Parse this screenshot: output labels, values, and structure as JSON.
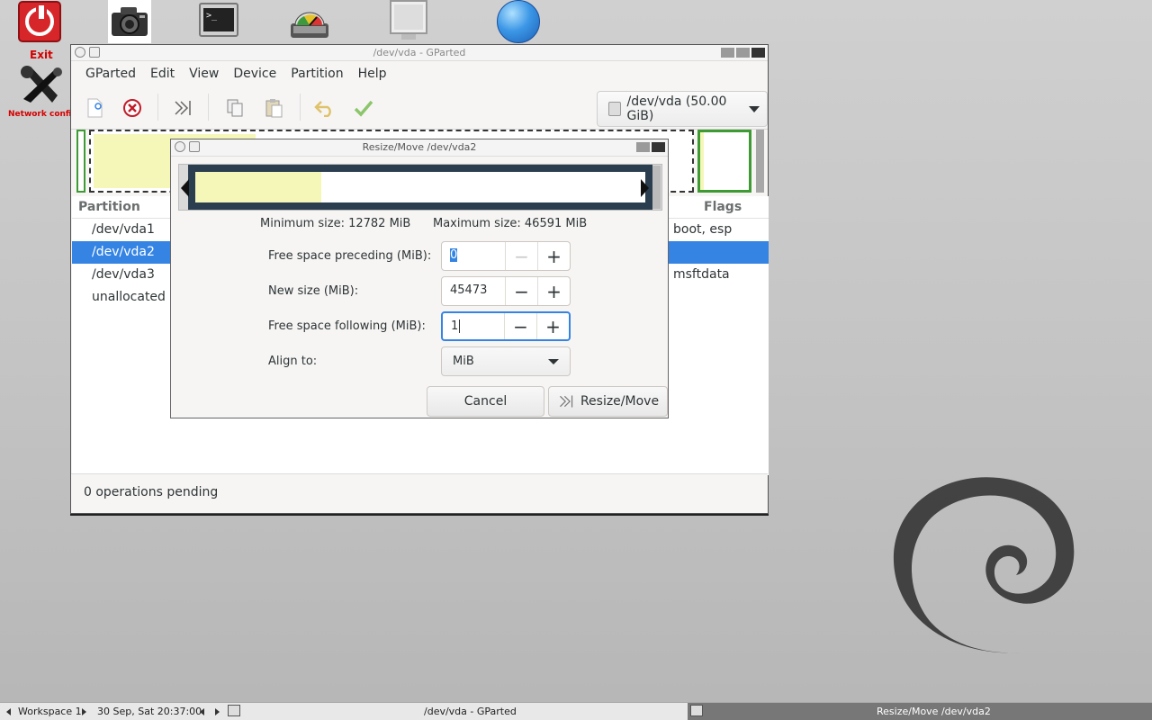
{
  "desktop": {
    "exit_label": "Exit",
    "network_label": "Network confi",
    "terminal_prompt": ">_"
  },
  "main_window": {
    "title": "/dev/vda - GParted",
    "menu": [
      "GParted",
      "Edit",
      "View",
      "Device",
      "Partition",
      "Help"
    ],
    "device_selector": "/dev/vda (50.00 GiB)",
    "columns": {
      "partition": "Partition",
      "flags": "Flags"
    },
    "rows": [
      {
        "partition": "/dev/vda1",
        "flags": "boot, esp"
      },
      {
        "partition": "/dev/vda2",
        "flags": ""
      },
      {
        "partition": "/dev/vda3",
        "flags": "msftdata"
      },
      {
        "partition": "unallocated",
        "flags": ""
      }
    ],
    "selected_row": 1,
    "status": "0 operations pending"
  },
  "dialog": {
    "title": "Resize/Move /dev/vda2",
    "min_size": "Minimum size: 12782 MiB",
    "max_size": "Maximum size: 46591 MiB",
    "used_fraction": 0.28,
    "fields": [
      {
        "label": "Free space preceding (MiB):",
        "value": "0"
      },
      {
        "label": "New size (MiB):",
        "value": "45473"
      },
      {
        "label": "Free space following (MiB):",
        "value": "1"
      }
    ],
    "align_label": "Align to:",
    "align_value": "MiB",
    "cancel": "Cancel",
    "resize_move": "Resize/Move"
  },
  "taskbar": {
    "workspace": "Workspace 1",
    "clock": "30 Sep, Sat 20:37:00",
    "task1": "/dev/vda - GParted",
    "task2": "Resize/Move /dev/vda2"
  },
  "colors": {
    "selection": "#3584e4",
    "used_space": "#f5f7b8",
    "partition_border": "#3e9a33",
    "exit_red": "#d7262a"
  }
}
